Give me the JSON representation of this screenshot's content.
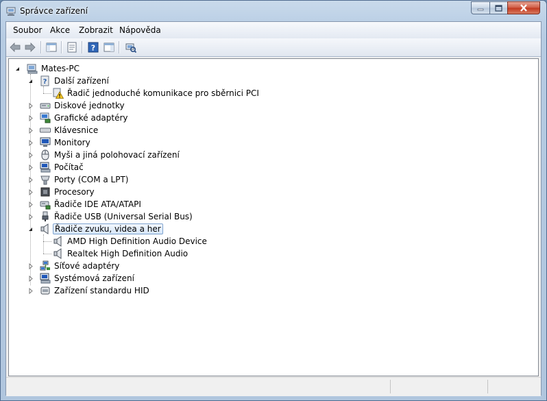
{
  "window": {
    "title": "Správce zařízení"
  },
  "menu": {
    "items": [
      "Soubor",
      "Akce",
      "Zobrazit",
      "Nápověda"
    ]
  },
  "toolbar": {
    "buttons": [
      "back-arrow-icon",
      "forward-arrow-icon",
      "show-hide-console-tree-icon",
      "properties-icon",
      "help-icon",
      "show-action-pane-icon",
      "scan-hardware-icon"
    ]
  },
  "tree": {
    "root": "Mates-PC",
    "items": [
      {
        "label": "Další zařízení",
        "expanded": true,
        "children": [
          "Řadič jednoduché komunikace pro sběrnici PCI"
        ]
      },
      {
        "label": "Diskové jednotky",
        "expanded": false
      },
      {
        "label": "Grafické adaptéry",
        "expanded": false
      },
      {
        "label": "Klávesnice",
        "expanded": false
      },
      {
        "label": "Monitory",
        "expanded": false
      },
      {
        "label": "Myši a jiná polohovací zařízení",
        "expanded": false
      },
      {
        "label": "Počítač",
        "expanded": false
      },
      {
        "label": "Porty (COM a LPT)",
        "expanded": false
      },
      {
        "label": "Procesory",
        "expanded": false
      },
      {
        "label": "Řadiče IDE ATA/ATAPI",
        "expanded": false
      },
      {
        "label": "Řadiče USB (Universal Serial Bus)",
        "expanded": false
      },
      {
        "label": "Řadiče zvuku, videa a her",
        "expanded": true,
        "selected": true,
        "children": [
          "AMD High Definition Audio Device",
          "Realtek High Definition Audio"
        ]
      },
      {
        "label": "Síťové adaptéry",
        "expanded": false
      },
      {
        "label": "Systémová zařízení",
        "expanded": false
      },
      {
        "label": "Zařízení standardu HID",
        "expanded": false
      }
    ]
  },
  "colors": {
    "selection_border": "#7da2ce",
    "title_bar": "#bcd0e6",
    "close_button": "#c2371e"
  }
}
